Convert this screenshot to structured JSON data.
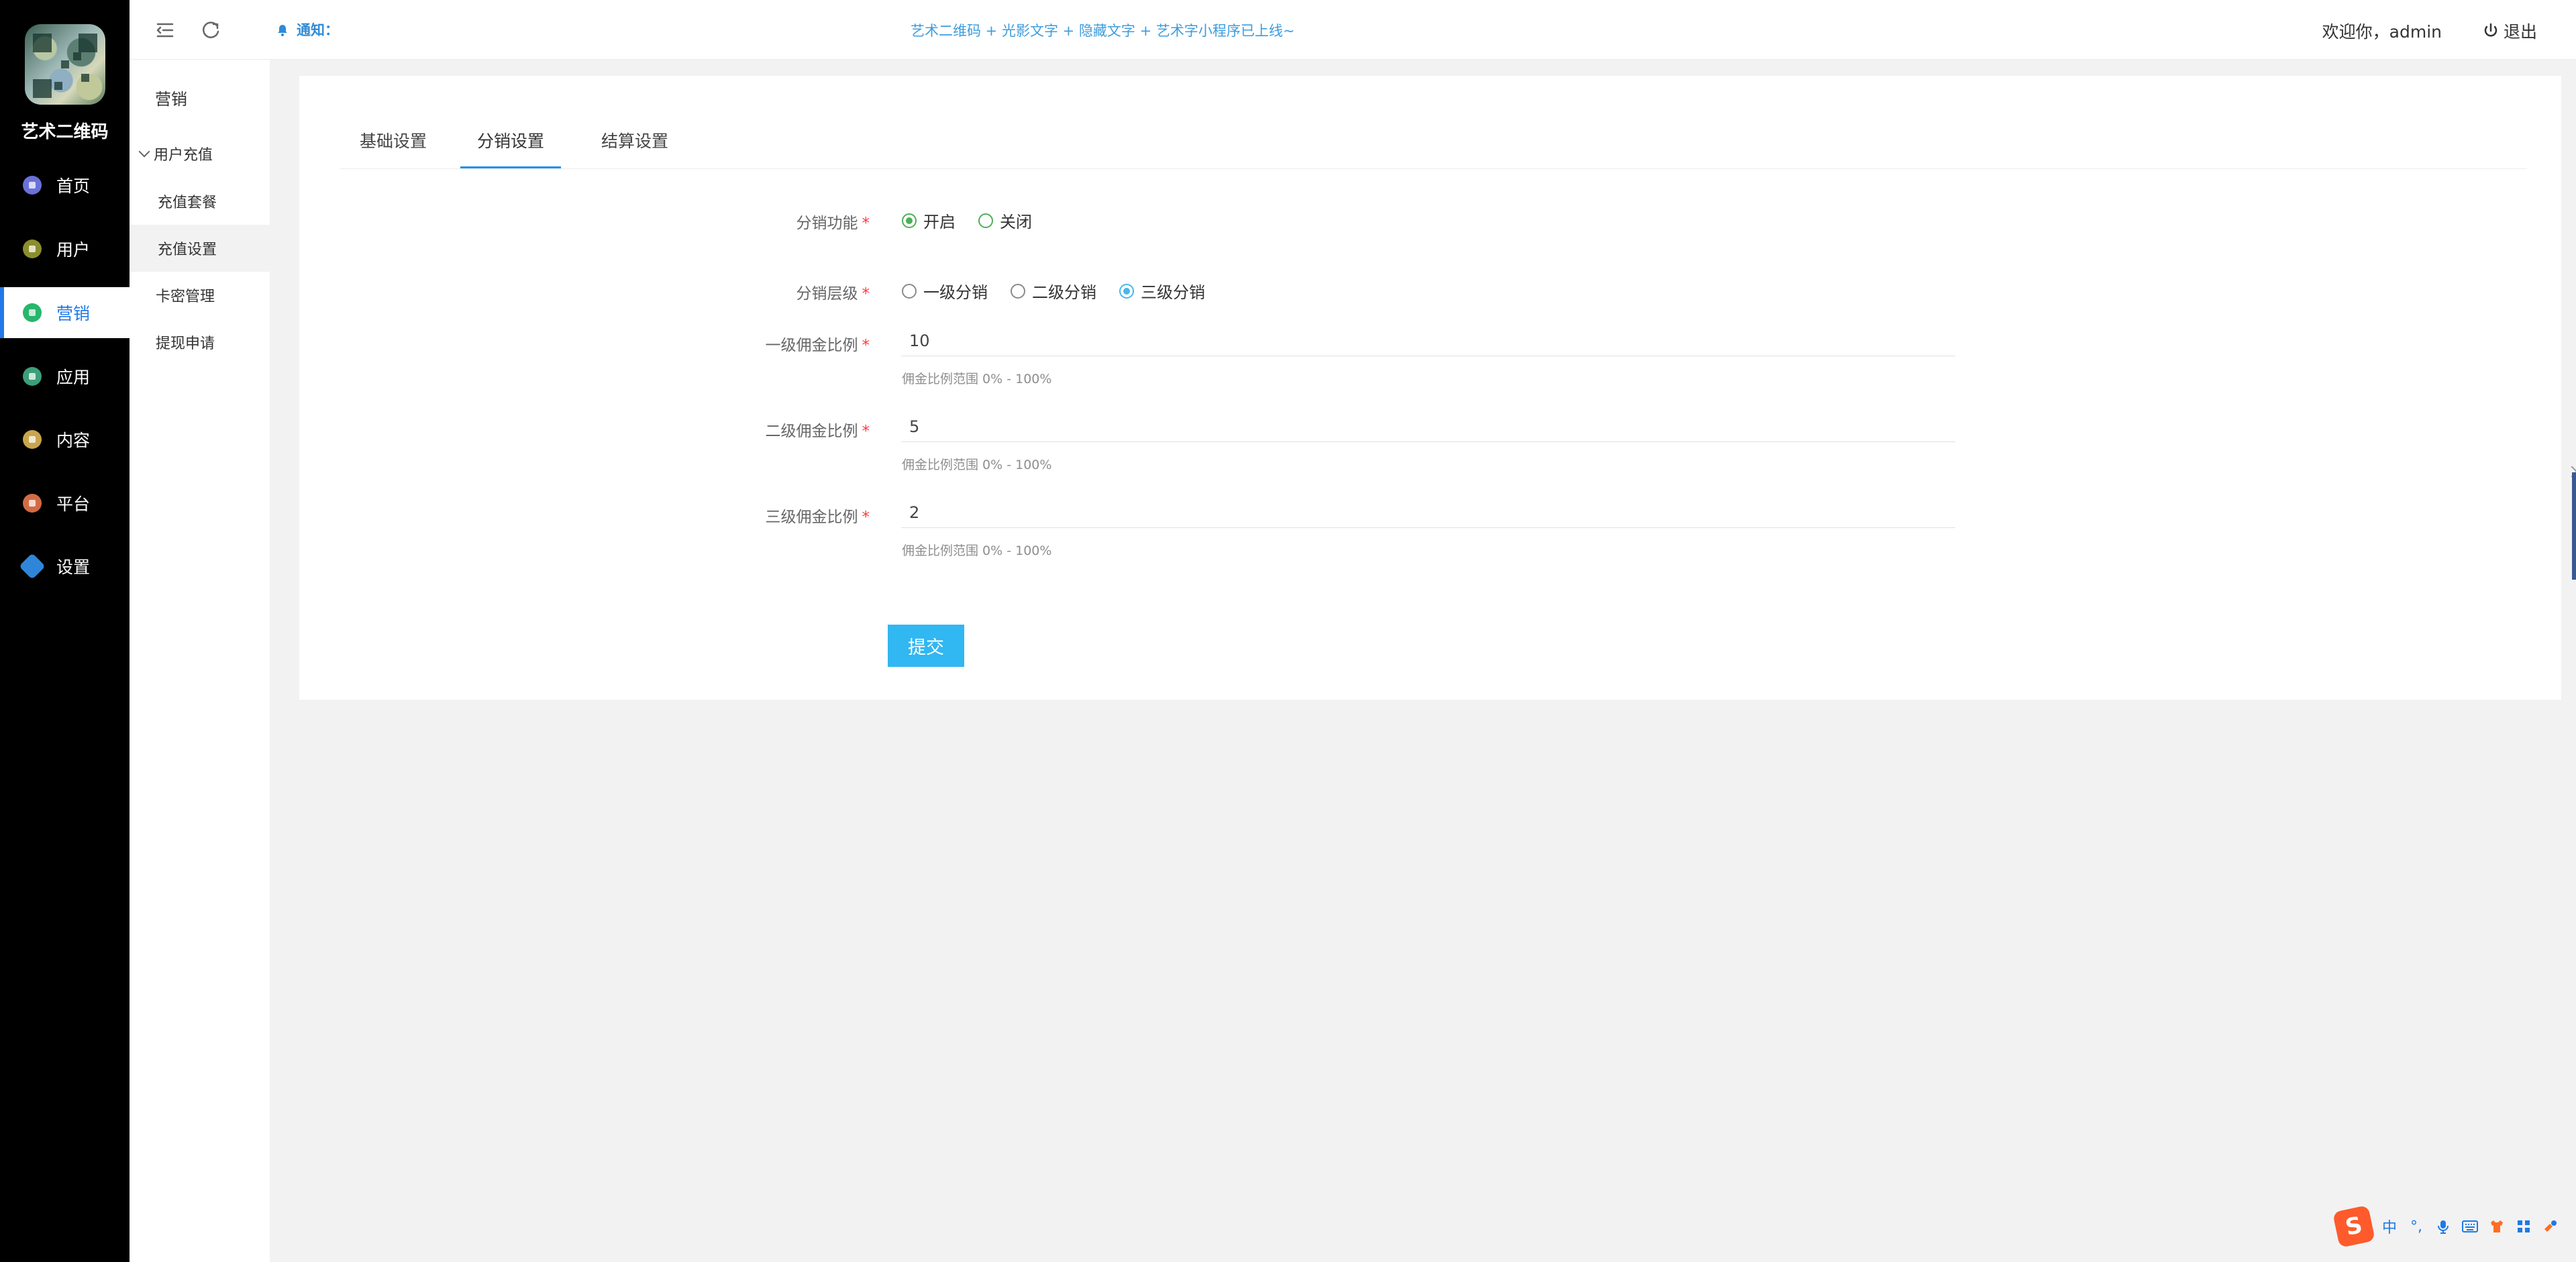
{
  "brand": {
    "name": "艺术二维码"
  },
  "nav": {
    "items": [
      {
        "label": "首页"
      },
      {
        "label": "用户"
      },
      {
        "label": "营销"
      },
      {
        "label": "应用"
      },
      {
        "label": "内容"
      },
      {
        "label": "平台"
      },
      {
        "label": "设置"
      }
    ]
  },
  "subnav": {
    "title": "营销",
    "group": "用户充值",
    "items": [
      {
        "label": "充值套餐"
      },
      {
        "label": "充值设置"
      },
      {
        "label": "卡密管理"
      },
      {
        "label": "提现申请"
      }
    ]
  },
  "header": {
    "notice_label": "通知：",
    "notice_text": "艺术二维码 + 光影文字 + 隐藏文字 + 艺术字小程序已上线~",
    "welcome": "欢迎你，admin",
    "logout": "退出"
  },
  "tabs": [
    {
      "label": "基础设置"
    },
    {
      "label": "分销设置"
    },
    {
      "label": "结算设置"
    }
  ],
  "form": {
    "distribution": {
      "label": "分销功能",
      "options": [
        "开启",
        "关闭"
      ],
      "selected": "开启"
    },
    "levels": {
      "label": "分销层级",
      "options": [
        "一级分销",
        "二级分销",
        "三级分销"
      ],
      "selected": "三级分销"
    },
    "level1": {
      "label": "一级佣金比例",
      "value": "10",
      "hint": "佣金比例范围 0% - 100%"
    },
    "level2": {
      "label": "二级佣金比例",
      "value": "5",
      "hint": "佣金比例范围 0% - 100%"
    },
    "level3": {
      "label": "三级佣金比例",
      "value": "2",
      "hint": "佣金比例范围 0% - 100%"
    },
    "submit": "提交",
    "required_mark": "*"
  },
  "tray": {
    "input_mode": "中",
    "punctuation": "°,"
  },
  "colors": {
    "accent": "#2391ea",
    "notice": "#3c9ddd",
    "submit": "#31b7f2",
    "green_radio": "#4daf58"
  },
  "icons": {
    "menu": "menu-collapse-icon",
    "refresh": "refresh-icon",
    "bell": "bell-icon",
    "power": "power-icon"
  }
}
